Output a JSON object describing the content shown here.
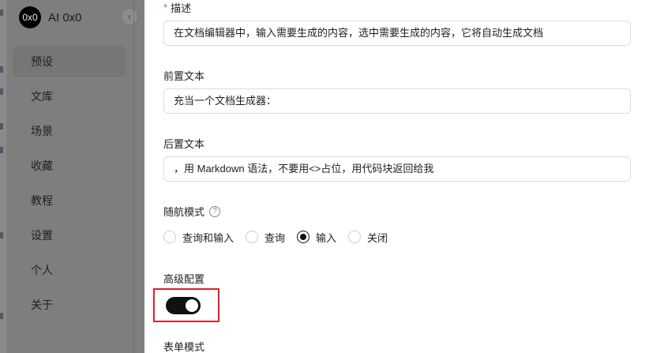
{
  "sidebar": {
    "logo_text": "0x0",
    "app_name": "AI 0x0",
    "collapse_glyph": "‹",
    "items": [
      {
        "label": "预设"
      },
      {
        "label": "文库"
      },
      {
        "label": "场景"
      },
      {
        "label": "收藏"
      },
      {
        "label": "教程"
      },
      {
        "label": "设置"
      },
      {
        "label": "个人"
      },
      {
        "label": "关于"
      }
    ]
  },
  "form": {
    "description": {
      "required_mark": "*",
      "label": "描述",
      "value": "在文档编辑器中，输入需要生成的内容，选中需要生成的内容，它将自动生成文档"
    },
    "prefix": {
      "label": "前置文本",
      "value": "充当一个文档生成器："
    },
    "suffix": {
      "label": "后置文本",
      "value": "，用 Markdown 语法，不要用<>占位，用代码块返回给我"
    },
    "follow_mode": {
      "label": "随航模式",
      "help_glyph": "?",
      "options": [
        {
          "label": "查询和输入",
          "selected": false
        },
        {
          "label": "查询",
          "selected": false
        },
        {
          "label": "输入",
          "selected": true
        },
        {
          "label": "关闭",
          "selected": false
        }
      ]
    },
    "advanced": {
      "label": "高级配置",
      "enabled": true
    },
    "form_mode": {
      "label": "表单模式"
    }
  },
  "colors": {
    "required": "#e34d59",
    "highlight_box": "#d9232c",
    "toggle_on": "#111111"
  }
}
